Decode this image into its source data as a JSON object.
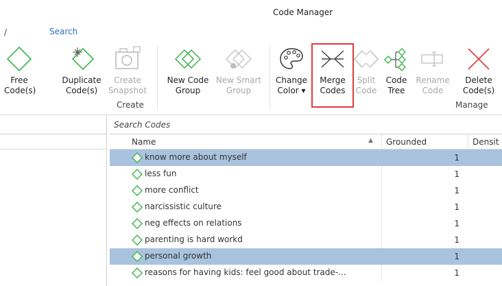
{
  "window": {
    "title": "Code Manager"
  },
  "tabs": {
    "prev": "/",
    "search": "Search"
  },
  "ribbon": {
    "free_codes": {
      "line1": "Free",
      "line2": "Code(s)"
    },
    "duplicate_codes": {
      "line1": "Duplicate",
      "line2": "Code(s)"
    },
    "create_snapshot": {
      "line1": "Create",
      "line2": "Snapshot"
    },
    "group_create": "Create",
    "new_code_group": {
      "line1": "New Code",
      "line2": "Group"
    },
    "new_smart_group": {
      "line1": "New Smart",
      "line2": "Group"
    },
    "change_color": {
      "line1": "Change",
      "line2": "Color ▾"
    },
    "merge_codes": {
      "line1": "Merge",
      "line2": "Codes"
    },
    "split_code": {
      "line1": "Split",
      "line2": "Code"
    },
    "code_tree": {
      "line1": "Code",
      "line2": "Tree"
    },
    "rename_code": {
      "line1": "Rename",
      "line2": "Code"
    },
    "delete_codes": {
      "line1": "Delete",
      "line2": "Code(s)"
    },
    "group_manage": "Manage"
  },
  "search": {
    "placeholder": "Search Codes"
  },
  "table": {
    "columns": {
      "name": "Name",
      "grounded": "Grounded",
      "density": "Densit"
    },
    "rows": [
      {
        "name": "know more about myself",
        "grounded": "1",
        "selected": true
      },
      {
        "name": "less fun",
        "grounded": "1",
        "selected": false
      },
      {
        "name": "more conflict",
        "grounded": "1",
        "selected": false
      },
      {
        "name": "narcissistic culture",
        "grounded": "1",
        "selected": false
      },
      {
        "name": "neg effects on relations",
        "grounded": "1",
        "selected": false
      },
      {
        "name": "parenting is hard workd",
        "grounded": "1",
        "selected": false
      },
      {
        "name": "personal growth",
        "grounded": "1",
        "selected": true
      },
      {
        "name": "reasons for having kids: feel good about trade-...",
        "grounded": "1",
        "selected": false
      }
    ]
  },
  "colors": {
    "code_green": "#3cb34a",
    "selection": "#a9c3de",
    "highlight_red": "#e03a3a",
    "delete_red": "#e53935"
  }
}
